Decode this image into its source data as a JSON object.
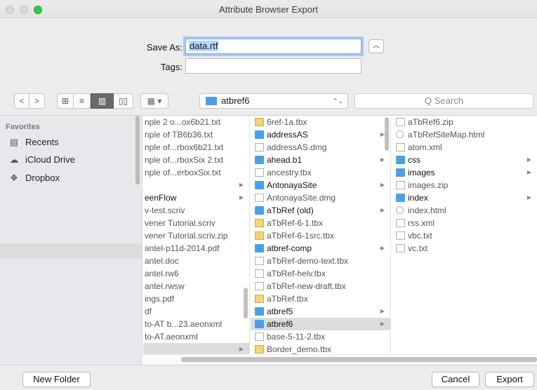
{
  "window": {
    "title": "Attribute Browser Export"
  },
  "save_as": {
    "label": "Save As:",
    "value": "data.rtf"
  },
  "tags": {
    "label": "Tags:",
    "value": ""
  },
  "toolbar": {
    "back_glyph": "<",
    "forward_glyph": ">",
    "icon_view_glyph": "⊞",
    "list_view_glyph": "≡",
    "column_view_glyph": "▥",
    "coverflow_view_glyph": "▯▯",
    "arrange_glyph": "▦ ▾",
    "location_label": "atbref6",
    "location_chevron": "⌃⌄",
    "search_placeholder": "Q Search"
  },
  "sidebar": {
    "heading": "Favorites",
    "items": [
      {
        "label": "Recents",
        "icon": "recents-icon"
      },
      {
        "label": "iCloud Drive",
        "icon": "cloud-icon"
      },
      {
        "label": "Dropbox",
        "icon": "dropbox-icon"
      }
    ]
  },
  "columns": {
    "col1": [
      {
        "name": "nple 2 o...ox6b21.txt",
        "kind": "file",
        "arrow": ""
      },
      {
        "name": "nple of TB6b36.txt",
        "kind": "file",
        "arrow": ""
      },
      {
        "name": "nple of...rbox6b21.txt",
        "kind": "file",
        "arrow": ""
      },
      {
        "name": "nple of...rboxSix 2.txt",
        "kind": "file",
        "arrow": ""
      },
      {
        "name": "nple of...erboxSix.txt",
        "kind": "file",
        "arrow": ""
      },
      {
        "name": "",
        "kind": "folder",
        "arrow": "▶"
      },
      {
        "name": "eenFlow",
        "kind": "folder",
        "arrow": "▶"
      },
      {
        "name": "v-test.scriv",
        "kind": "file",
        "arrow": ""
      },
      {
        "name": "vener Tutorial.scriv",
        "kind": "file",
        "arrow": ""
      },
      {
        "name": "vener Tutorial.scriv.zip",
        "kind": "file",
        "arrow": ""
      },
      {
        "name": "antel-p11d-2014.pdf",
        "kind": "file",
        "arrow": ""
      },
      {
        "name": "antel.doc",
        "kind": "file",
        "arrow": ""
      },
      {
        "name": "antel.rw6",
        "kind": "file",
        "arrow": ""
      },
      {
        "name": "antel.rwsw",
        "kind": "file",
        "arrow": ""
      },
      {
        "name": "ings.pdf",
        "kind": "file",
        "arrow": ""
      },
      {
        "name": "df",
        "kind": "file",
        "arrow": ""
      },
      {
        "name": "to-AT b...23.aeonxml",
        "kind": "file",
        "arrow": ""
      },
      {
        "name": "to-AT.aeonxml",
        "kind": "file",
        "arrow": ""
      },
      {
        "name": "",
        "kind": "folder",
        "arrow": "▶",
        "selected": true
      }
    ],
    "col2": [
      {
        "name": "6ref-1a.tbx",
        "kind": "tbx",
        "arrow": ""
      },
      {
        "name": "addressAS",
        "kind": "folder",
        "arrow": "▶"
      },
      {
        "name": "addressAS.dmg",
        "kind": "doc",
        "arrow": ""
      },
      {
        "name": "ahead.b1",
        "kind": "folder",
        "arrow": "▶"
      },
      {
        "name": "ancestry.tbx",
        "kind": "doc",
        "arrow": ""
      },
      {
        "name": "AntonayaSite",
        "kind": "folder",
        "arrow": "▶"
      },
      {
        "name": "AntonayaSite.dmg",
        "kind": "doc",
        "arrow": ""
      },
      {
        "name": "aTbRef (old)",
        "kind": "folder",
        "arrow": "▶"
      },
      {
        "name": "aTbRef-6-1.tbx",
        "kind": "tbx",
        "arrow": ""
      },
      {
        "name": "aTbRef-6-1src.tbx",
        "kind": "tbx",
        "arrow": ""
      },
      {
        "name": "atbref-comp",
        "kind": "folder",
        "arrow": "▶"
      },
      {
        "name": "aTbRef-demo-text.tbx",
        "kind": "doc",
        "arrow": ""
      },
      {
        "name": "aTbRef-helv.tbx",
        "kind": "doc",
        "arrow": ""
      },
      {
        "name": "aTbRef-new-draft.tbx",
        "kind": "doc",
        "arrow": ""
      },
      {
        "name": "aTbRef.tbx",
        "kind": "tbx",
        "arrow": ""
      },
      {
        "name": "atbref5",
        "kind": "folder",
        "arrow": "▶"
      },
      {
        "name": "atbref6",
        "kind": "folder",
        "arrow": "▶",
        "selected": true
      },
      {
        "name": "base-5-11-2.tbx",
        "kind": "doc",
        "arrow": ""
      },
      {
        "name": "Border_demo.tbx",
        "kind": "tbx",
        "arrow": ""
      }
    ],
    "col3": [
      {
        "name": "aTbRef6.zip",
        "kind": "doc",
        "arrow": ""
      },
      {
        "name": "aTbRefSiteMap.html",
        "kind": "globe",
        "arrow": ""
      },
      {
        "name": "atom.xml",
        "kind": "doc",
        "arrow": ""
      },
      {
        "name": "css",
        "kind": "folder",
        "arrow": "▶"
      },
      {
        "name": "images",
        "kind": "folder",
        "arrow": "▶"
      },
      {
        "name": "images.zip",
        "kind": "doc",
        "arrow": ""
      },
      {
        "name": "index",
        "kind": "folder",
        "arrow": "▶"
      },
      {
        "name": "index.html",
        "kind": "globe",
        "arrow": ""
      },
      {
        "name": "rss.xml",
        "kind": "doc",
        "arrow": ""
      },
      {
        "name": "vbc.txt",
        "kind": "doc",
        "arrow": ""
      },
      {
        "name": "vc.txt",
        "kind": "doc",
        "arrow": ""
      }
    ]
  },
  "footer": {
    "new_folder_label": "New Folder",
    "cancel_label": "Cancel",
    "export_label": "Export"
  },
  "colors": {
    "accent": "#4aa0e6",
    "selection": "#dcdcdc",
    "focus_ring": "#a9c8f3"
  }
}
